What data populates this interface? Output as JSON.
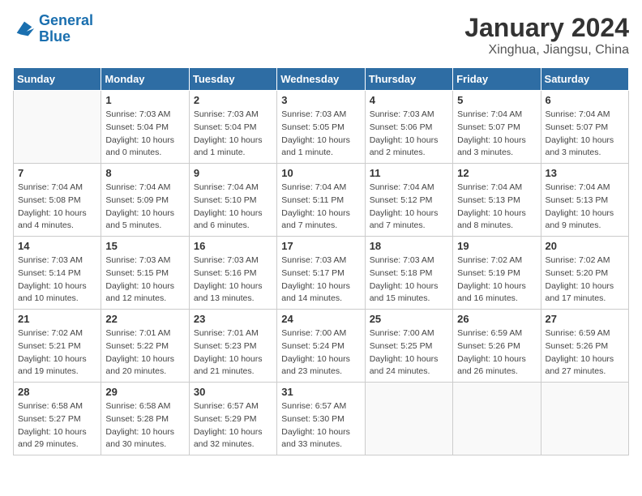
{
  "logo": {
    "line1": "General",
    "line2": "Blue"
  },
  "title": "January 2024",
  "subtitle": "Xinghua, Jiangsu, China",
  "days_of_week": [
    "Sunday",
    "Monday",
    "Tuesday",
    "Wednesday",
    "Thursday",
    "Friday",
    "Saturday"
  ],
  "weeks": [
    [
      {
        "num": "",
        "sunrise": "",
        "sunset": "",
        "daylight": ""
      },
      {
        "num": "1",
        "sunrise": "Sunrise: 7:03 AM",
        "sunset": "Sunset: 5:04 PM",
        "daylight": "Daylight: 10 hours and 0 minutes."
      },
      {
        "num": "2",
        "sunrise": "Sunrise: 7:03 AM",
        "sunset": "Sunset: 5:04 PM",
        "daylight": "Daylight: 10 hours and 1 minute."
      },
      {
        "num": "3",
        "sunrise": "Sunrise: 7:03 AM",
        "sunset": "Sunset: 5:05 PM",
        "daylight": "Daylight: 10 hours and 1 minute."
      },
      {
        "num": "4",
        "sunrise": "Sunrise: 7:03 AM",
        "sunset": "Sunset: 5:06 PM",
        "daylight": "Daylight: 10 hours and 2 minutes."
      },
      {
        "num": "5",
        "sunrise": "Sunrise: 7:04 AM",
        "sunset": "Sunset: 5:07 PM",
        "daylight": "Daylight: 10 hours and 3 minutes."
      },
      {
        "num": "6",
        "sunrise": "Sunrise: 7:04 AM",
        "sunset": "Sunset: 5:07 PM",
        "daylight": "Daylight: 10 hours and 3 minutes."
      }
    ],
    [
      {
        "num": "7",
        "sunrise": "Sunrise: 7:04 AM",
        "sunset": "Sunset: 5:08 PM",
        "daylight": "Daylight: 10 hours and 4 minutes."
      },
      {
        "num": "8",
        "sunrise": "Sunrise: 7:04 AM",
        "sunset": "Sunset: 5:09 PM",
        "daylight": "Daylight: 10 hours and 5 minutes."
      },
      {
        "num": "9",
        "sunrise": "Sunrise: 7:04 AM",
        "sunset": "Sunset: 5:10 PM",
        "daylight": "Daylight: 10 hours and 6 minutes."
      },
      {
        "num": "10",
        "sunrise": "Sunrise: 7:04 AM",
        "sunset": "Sunset: 5:11 PM",
        "daylight": "Daylight: 10 hours and 7 minutes."
      },
      {
        "num": "11",
        "sunrise": "Sunrise: 7:04 AM",
        "sunset": "Sunset: 5:12 PM",
        "daylight": "Daylight: 10 hours and 7 minutes."
      },
      {
        "num": "12",
        "sunrise": "Sunrise: 7:04 AM",
        "sunset": "Sunset: 5:13 PM",
        "daylight": "Daylight: 10 hours and 8 minutes."
      },
      {
        "num": "13",
        "sunrise": "Sunrise: 7:04 AM",
        "sunset": "Sunset: 5:13 PM",
        "daylight": "Daylight: 10 hours and 9 minutes."
      }
    ],
    [
      {
        "num": "14",
        "sunrise": "Sunrise: 7:03 AM",
        "sunset": "Sunset: 5:14 PM",
        "daylight": "Daylight: 10 hours and 10 minutes."
      },
      {
        "num": "15",
        "sunrise": "Sunrise: 7:03 AM",
        "sunset": "Sunset: 5:15 PM",
        "daylight": "Daylight: 10 hours and 12 minutes."
      },
      {
        "num": "16",
        "sunrise": "Sunrise: 7:03 AM",
        "sunset": "Sunset: 5:16 PM",
        "daylight": "Daylight: 10 hours and 13 minutes."
      },
      {
        "num": "17",
        "sunrise": "Sunrise: 7:03 AM",
        "sunset": "Sunset: 5:17 PM",
        "daylight": "Daylight: 10 hours and 14 minutes."
      },
      {
        "num": "18",
        "sunrise": "Sunrise: 7:03 AM",
        "sunset": "Sunset: 5:18 PM",
        "daylight": "Daylight: 10 hours and 15 minutes."
      },
      {
        "num": "19",
        "sunrise": "Sunrise: 7:02 AM",
        "sunset": "Sunset: 5:19 PM",
        "daylight": "Daylight: 10 hours and 16 minutes."
      },
      {
        "num": "20",
        "sunrise": "Sunrise: 7:02 AM",
        "sunset": "Sunset: 5:20 PM",
        "daylight": "Daylight: 10 hours and 17 minutes."
      }
    ],
    [
      {
        "num": "21",
        "sunrise": "Sunrise: 7:02 AM",
        "sunset": "Sunset: 5:21 PM",
        "daylight": "Daylight: 10 hours and 19 minutes."
      },
      {
        "num": "22",
        "sunrise": "Sunrise: 7:01 AM",
        "sunset": "Sunset: 5:22 PM",
        "daylight": "Daylight: 10 hours and 20 minutes."
      },
      {
        "num": "23",
        "sunrise": "Sunrise: 7:01 AM",
        "sunset": "Sunset: 5:23 PM",
        "daylight": "Daylight: 10 hours and 21 minutes."
      },
      {
        "num": "24",
        "sunrise": "Sunrise: 7:00 AM",
        "sunset": "Sunset: 5:24 PM",
        "daylight": "Daylight: 10 hours and 23 minutes."
      },
      {
        "num": "25",
        "sunrise": "Sunrise: 7:00 AM",
        "sunset": "Sunset: 5:25 PM",
        "daylight": "Daylight: 10 hours and 24 minutes."
      },
      {
        "num": "26",
        "sunrise": "Sunrise: 6:59 AM",
        "sunset": "Sunset: 5:26 PM",
        "daylight": "Daylight: 10 hours and 26 minutes."
      },
      {
        "num": "27",
        "sunrise": "Sunrise: 6:59 AM",
        "sunset": "Sunset: 5:26 PM",
        "daylight": "Daylight: 10 hours and 27 minutes."
      }
    ],
    [
      {
        "num": "28",
        "sunrise": "Sunrise: 6:58 AM",
        "sunset": "Sunset: 5:27 PM",
        "daylight": "Daylight: 10 hours and 29 minutes."
      },
      {
        "num": "29",
        "sunrise": "Sunrise: 6:58 AM",
        "sunset": "Sunset: 5:28 PM",
        "daylight": "Daylight: 10 hours and 30 minutes."
      },
      {
        "num": "30",
        "sunrise": "Sunrise: 6:57 AM",
        "sunset": "Sunset: 5:29 PM",
        "daylight": "Daylight: 10 hours and 32 minutes."
      },
      {
        "num": "31",
        "sunrise": "Sunrise: 6:57 AM",
        "sunset": "Sunset: 5:30 PM",
        "daylight": "Daylight: 10 hours and 33 minutes."
      },
      {
        "num": "",
        "sunrise": "",
        "sunset": "",
        "daylight": ""
      },
      {
        "num": "",
        "sunrise": "",
        "sunset": "",
        "daylight": ""
      },
      {
        "num": "",
        "sunrise": "",
        "sunset": "",
        "daylight": ""
      }
    ]
  ]
}
